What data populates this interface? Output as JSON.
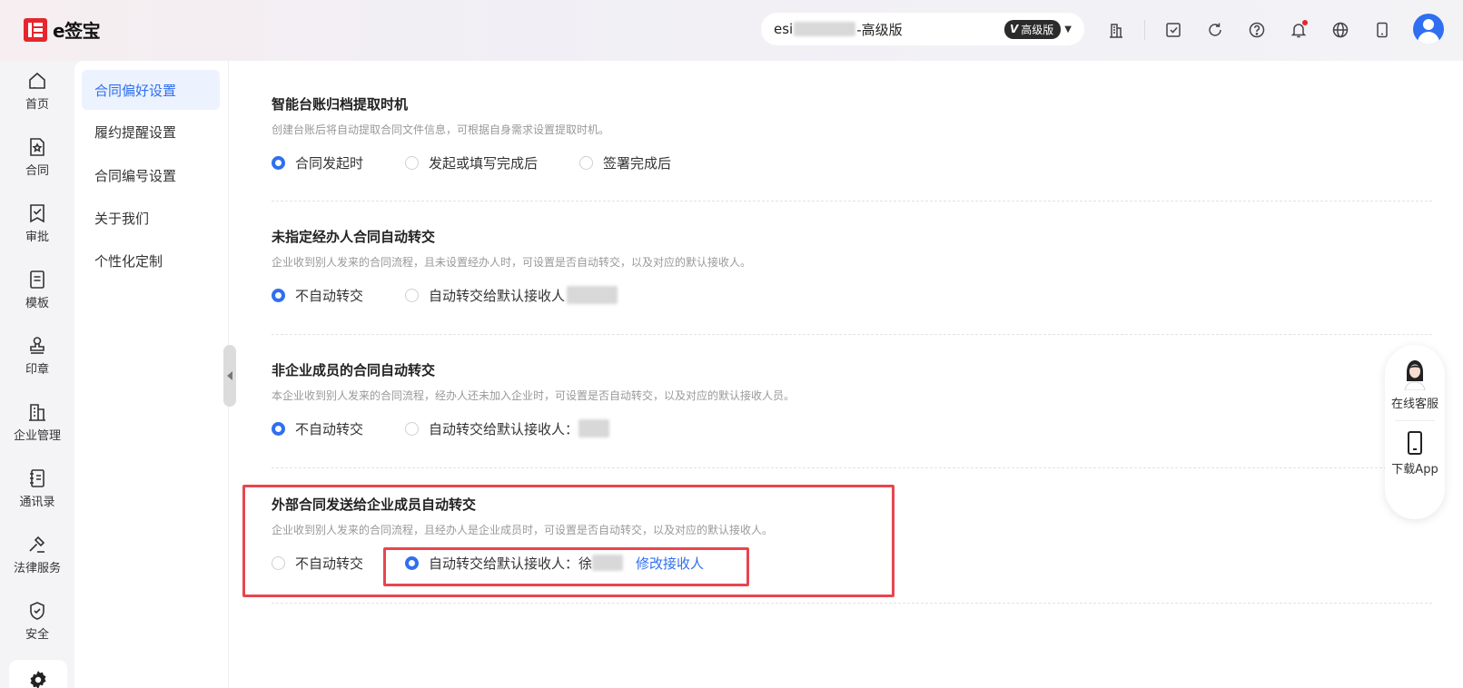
{
  "app": {
    "logo_text": "e签宝"
  },
  "tenant": {
    "name_prefix": "esi",
    "name_suffix": "-高级版",
    "badge_mark": "V",
    "badge_label": "高级版"
  },
  "top_icons": [
    "building-icon",
    "todo-check-icon",
    "refresh-icon",
    "help-icon",
    "bell-icon",
    "globe-icon",
    "phone-icon"
  ],
  "nav": {
    "items": [
      {
        "label": "首页",
        "icon": "home-icon"
      },
      {
        "label": "合同",
        "icon": "contract-icon"
      },
      {
        "label": "审批",
        "icon": "approval-icon"
      },
      {
        "label": "模板",
        "icon": "template-icon"
      },
      {
        "label": "印章",
        "icon": "seal-icon"
      },
      {
        "label": "企业管理",
        "icon": "enterprise-icon"
      },
      {
        "label": "通讯录",
        "icon": "contacts-icon"
      },
      {
        "label": "法律服务",
        "icon": "legal-icon"
      },
      {
        "label": "安全",
        "icon": "shield-icon"
      }
    ],
    "active_icon": "settings-gear-icon"
  },
  "subnav": {
    "items": [
      "合同偏好设置",
      "履约提醒设置",
      "合同编号设置",
      "关于我们",
      "个性化定制"
    ],
    "active_index": 0
  },
  "sections": [
    {
      "title": "智能台账归档提取时机",
      "desc": "创建台账后将自动提取合同文件信息，可根据自身需求设置提取时机。",
      "options": [
        "合同发起时",
        "发起或填写完成后",
        "签署完成后"
      ],
      "selected": 0
    },
    {
      "title": "未指定经办人合同自动转交",
      "desc": "企业收到别人发来的合同流程，且未设置经办人时，可设置是否自动转交，以及对应的默认接收人。",
      "options": [
        "不自动转交",
        "自动转交给默认接收人"
      ],
      "selected": 0
    },
    {
      "title": "非企业成员的合同自动转交",
      "desc": "本企业收到别人发来的合同流程，经办人还未加入企业时，可设置是否自动转交，以及对应的默认接收人员。",
      "options": [
        "不自动转交",
        "自动转交给默认接收人："
      ],
      "selected": 0
    },
    {
      "title": "外部合同发送给企业成员自动转交",
      "desc": "企业收到别人发来的合同流程，且经办人是企业成员时，可设置是否自动转交，以及对应的默认接收人。",
      "options": [
        "不自动转交",
        "自动转交给默认接收人：徐"
      ],
      "selected": 1,
      "link": "修改接收人"
    }
  ],
  "float_panel": {
    "service_label": "在线客服",
    "download_label": "下载App"
  },
  "colors": {
    "accent": "#2f6ff0",
    "highlight": "#e8454f",
    "brand_red": "#e5262e"
  }
}
